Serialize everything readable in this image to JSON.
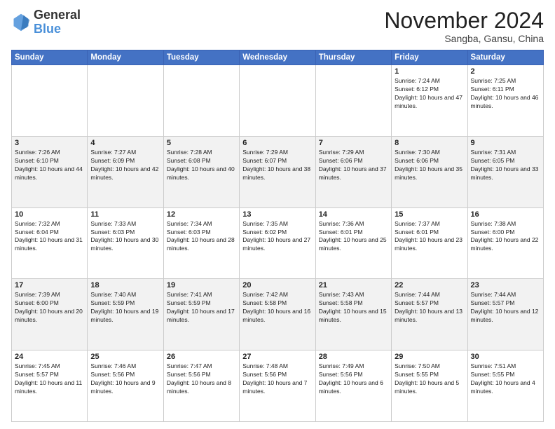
{
  "header": {
    "logo_general": "General",
    "logo_blue": "Blue",
    "month_title": "November 2024",
    "location": "Sangba, Gansu, China"
  },
  "weekdays": [
    "Sunday",
    "Monday",
    "Tuesday",
    "Wednesday",
    "Thursday",
    "Friday",
    "Saturday"
  ],
  "weeks": [
    [
      {
        "day": "",
        "info": ""
      },
      {
        "day": "",
        "info": ""
      },
      {
        "day": "",
        "info": ""
      },
      {
        "day": "",
        "info": ""
      },
      {
        "day": "",
        "info": ""
      },
      {
        "day": "1",
        "info": "Sunrise: 7:24 AM\nSunset: 6:12 PM\nDaylight: 10 hours and 47 minutes."
      },
      {
        "day": "2",
        "info": "Sunrise: 7:25 AM\nSunset: 6:11 PM\nDaylight: 10 hours and 46 minutes."
      }
    ],
    [
      {
        "day": "3",
        "info": "Sunrise: 7:26 AM\nSunset: 6:10 PM\nDaylight: 10 hours and 44 minutes."
      },
      {
        "day": "4",
        "info": "Sunrise: 7:27 AM\nSunset: 6:09 PM\nDaylight: 10 hours and 42 minutes."
      },
      {
        "day": "5",
        "info": "Sunrise: 7:28 AM\nSunset: 6:08 PM\nDaylight: 10 hours and 40 minutes."
      },
      {
        "day": "6",
        "info": "Sunrise: 7:29 AM\nSunset: 6:07 PM\nDaylight: 10 hours and 38 minutes."
      },
      {
        "day": "7",
        "info": "Sunrise: 7:29 AM\nSunset: 6:06 PM\nDaylight: 10 hours and 37 minutes."
      },
      {
        "day": "8",
        "info": "Sunrise: 7:30 AM\nSunset: 6:06 PM\nDaylight: 10 hours and 35 minutes."
      },
      {
        "day": "9",
        "info": "Sunrise: 7:31 AM\nSunset: 6:05 PM\nDaylight: 10 hours and 33 minutes."
      }
    ],
    [
      {
        "day": "10",
        "info": "Sunrise: 7:32 AM\nSunset: 6:04 PM\nDaylight: 10 hours and 31 minutes."
      },
      {
        "day": "11",
        "info": "Sunrise: 7:33 AM\nSunset: 6:03 PM\nDaylight: 10 hours and 30 minutes."
      },
      {
        "day": "12",
        "info": "Sunrise: 7:34 AM\nSunset: 6:03 PM\nDaylight: 10 hours and 28 minutes."
      },
      {
        "day": "13",
        "info": "Sunrise: 7:35 AM\nSunset: 6:02 PM\nDaylight: 10 hours and 27 minutes."
      },
      {
        "day": "14",
        "info": "Sunrise: 7:36 AM\nSunset: 6:01 PM\nDaylight: 10 hours and 25 minutes."
      },
      {
        "day": "15",
        "info": "Sunrise: 7:37 AM\nSunset: 6:01 PM\nDaylight: 10 hours and 23 minutes."
      },
      {
        "day": "16",
        "info": "Sunrise: 7:38 AM\nSunset: 6:00 PM\nDaylight: 10 hours and 22 minutes."
      }
    ],
    [
      {
        "day": "17",
        "info": "Sunrise: 7:39 AM\nSunset: 6:00 PM\nDaylight: 10 hours and 20 minutes."
      },
      {
        "day": "18",
        "info": "Sunrise: 7:40 AM\nSunset: 5:59 PM\nDaylight: 10 hours and 19 minutes."
      },
      {
        "day": "19",
        "info": "Sunrise: 7:41 AM\nSunset: 5:59 PM\nDaylight: 10 hours and 17 minutes."
      },
      {
        "day": "20",
        "info": "Sunrise: 7:42 AM\nSunset: 5:58 PM\nDaylight: 10 hours and 16 minutes."
      },
      {
        "day": "21",
        "info": "Sunrise: 7:43 AM\nSunset: 5:58 PM\nDaylight: 10 hours and 15 minutes."
      },
      {
        "day": "22",
        "info": "Sunrise: 7:44 AM\nSunset: 5:57 PM\nDaylight: 10 hours and 13 minutes."
      },
      {
        "day": "23",
        "info": "Sunrise: 7:44 AM\nSunset: 5:57 PM\nDaylight: 10 hours and 12 minutes."
      }
    ],
    [
      {
        "day": "24",
        "info": "Sunrise: 7:45 AM\nSunset: 5:57 PM\nDaylight: 10 hours and 11 minutes."
      },
      {
        "day": "25",
        "info": "Sunrise: 7:46 AM\nSunset: 5:56 PM\nDaylight: 10 hours and 9 minutes."
      },
      {
        "day": "26",
        "info": "Sunrise: 7:47 AM\nSunset: 5:56 PM\nDaylight: 10 hours and 8 minutes."
      },
      {
        "day": "27",
        "info": "Sunrise: 7:48 AM\nSunset: 5:56 PM\nDaylight: 10 hours and 7 minutes."
      },
      {
        "day": "28",
        "info": "Sunrise: 7:49 AM\nSunset: 5:56 PM\nDaylight: 10 hours and 6 minutes."
      },
      {
        "day": "29",
        "info": "Sunrise: 7:50 AM\nSunset: 5:55 PM\nDaylight: 10 hours and 5 minutes."
      },
      {
        "day": "30",
        "info": "Sunrise: 7:51 AM\nSunset: 5:55 PM\nDaylight: 10 hours and 4 minutes."
      }
    ]
  ]
}
